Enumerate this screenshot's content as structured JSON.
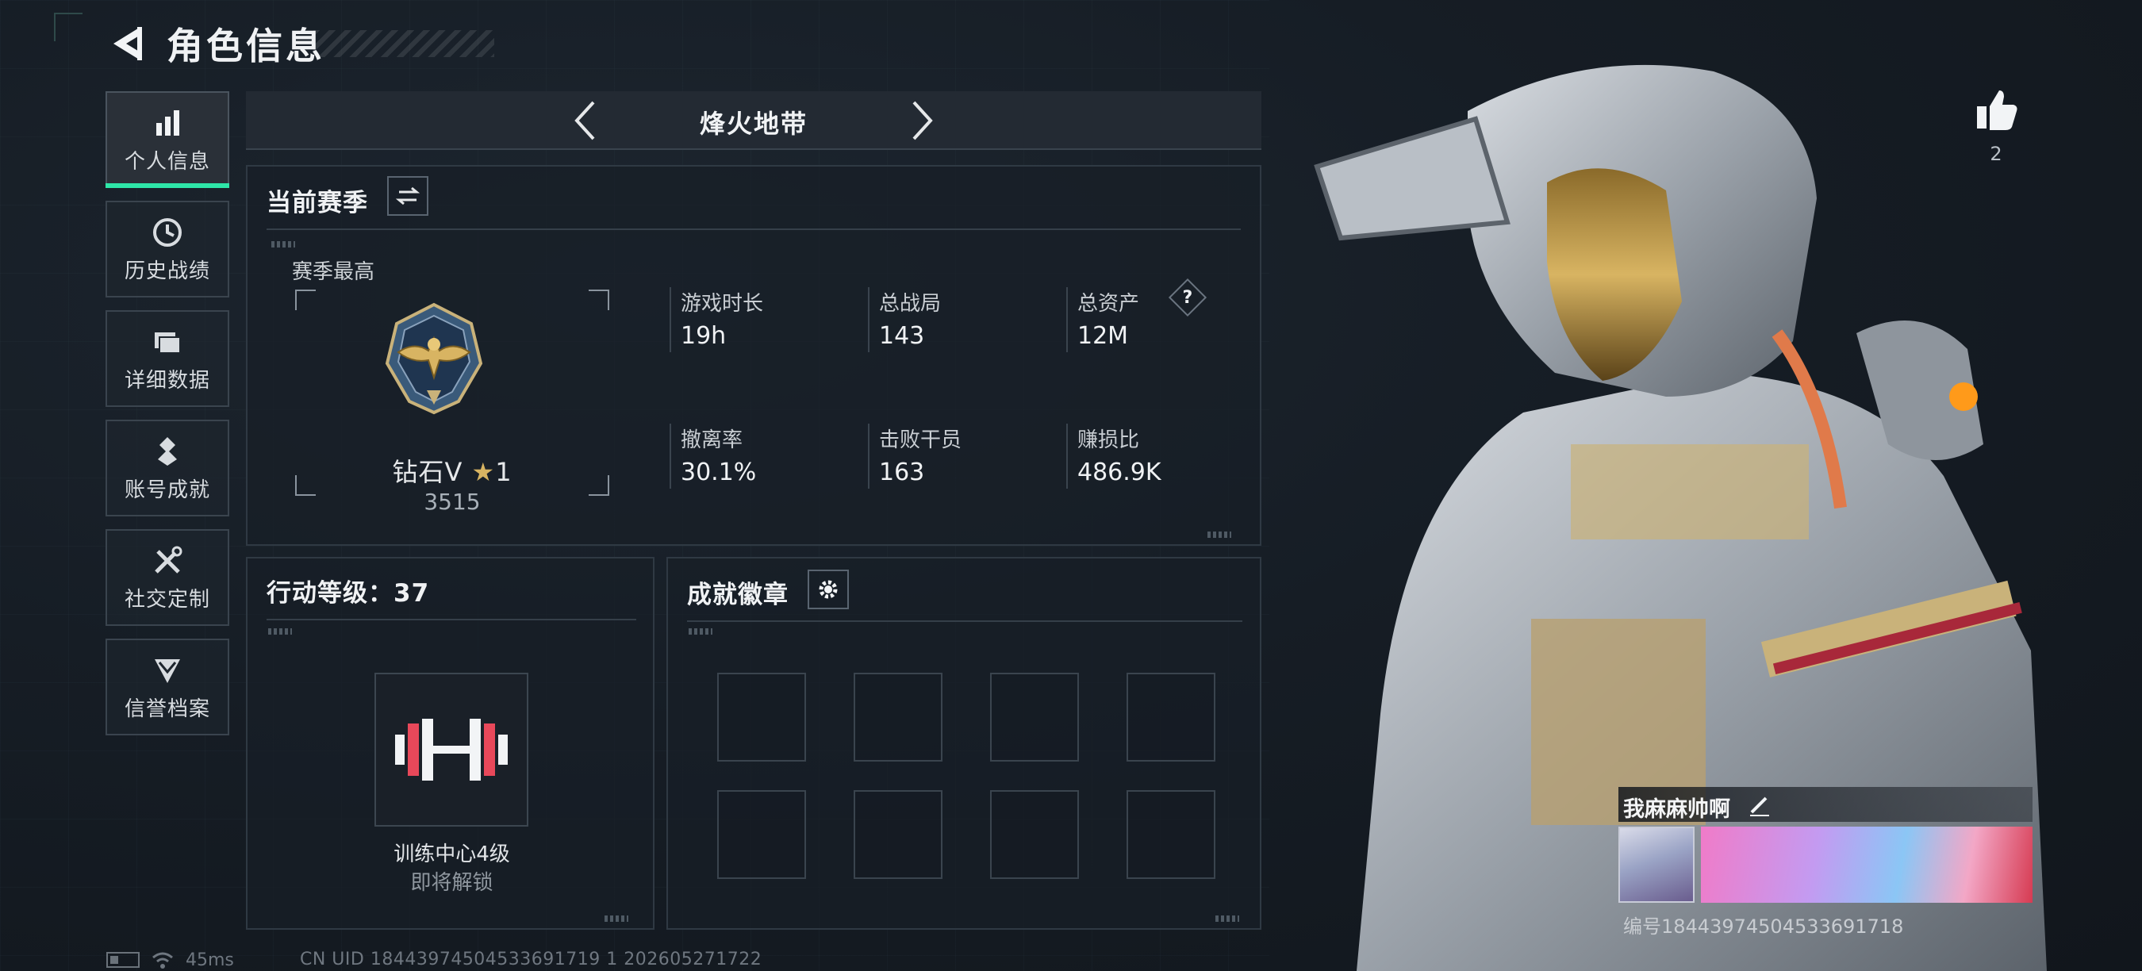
{
  "header": {
    "title": "角色信息",
    "back_icon": "back-arrow-icon"
  },
  "sidebar": {
    "items": [
      {
        "label": "个人信息",
        "icon": "bar-chart-icon",
        "active": true
      },
      {
        "label": "历史战绩",
        "icon": "clock-history-icon",
        "active": false
      },
      {
        "label": "详细数据",
        "icon": "folder-stack-icon",
        "active": false
      },
      {
        "label": "账号成就",
        "icon": "medal-icon",
        "active": false
      },
      {
        "label": "社交定制",
        "icon": "tools-icon",
        "active": false
      },
      {
        "label": "信誉档案",
        "icon": "shield-chevron-icon",
        "active": false
      }
    ],
    "accent": "#2ee6a8"
  },
  "mode_nav": {
    "title": "烽火地带"
  },
  "season": {
    "heading": "当前赛季",
    "best_label": "赛季最高",
    "rank_name": "钻石V",
    "rank_stars": "1",
    "rank_score": "3515",
    "stats": [
      {
        "label": "游戏时长",
        "value": "19h"
      },
      {
        "label": "总战局",
        "value": "143"
      },
      {
        "label": "总资产",
        "value": "12M",
        "help": "?"
      },
      {
        "label": "撤离率",
        "value": "30.1%"
      },
      {
        "label": "击败干员",
        "value": "163"
      },
      {
        "label": "赚损比",
        "value": "486.9K"
      }
    ]
  },
  "level": {
    "heading": "行动等级：37",
    "training_label": "训练中心4级",
    "training_sub": "即将解锁"
  },
  "badges": {
    "heading": "成就徽章",
    "slots": 8
  },
  "profile": {
    "likes": "2",
    "player_name": "我麻麻帅啊",
    "player_id": "编号18443974504533691718"
  },
  "status_bar": {
    "ping": "45ms",
    "uid_line": "CN UID 18443974504533691719 1 202605271722"
  }
}
